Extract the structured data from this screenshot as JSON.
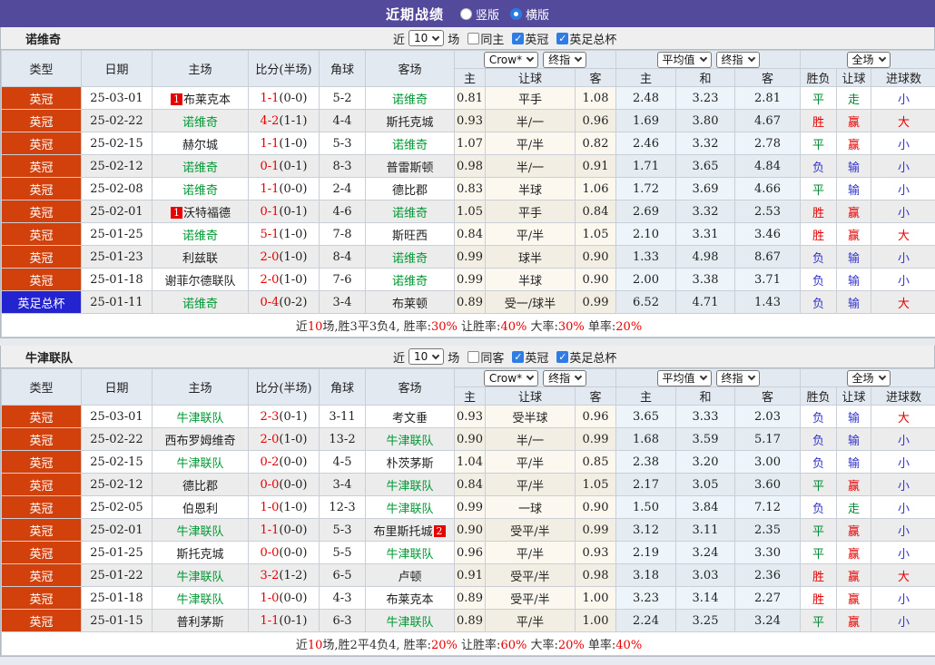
{
  "colors": {
    "titlebar_purple": "#534a9c",
    "league_badge_orange": "#d2410c",
    "cup_badge_blue": "#2323cf",
    "team_highlight_green": "#009933",
    "score_red": "#e60000",
    "win_red": "#e60000",
    "draw_green": "#008833",
    "lose_blue": "#3434cd",
    "checkbox_blue": "#2e7ce4"
  },
  "titlebar": {
    "title": "近期战绩",
    "radios": [
      {
        "label": "竖版",
        "selected": false
      },
      {
        "label": "横版",
        "selected": true
      }
    ]
  },
  "column_headers": {
    "static": [
      "类型",
      "日期",
      "主场",
      "比分(半场)",
      "角球",
      "客场"
    ],
    "sub": [
      "主",
      "让球",
      "客",
      "主",
      "和",
      "客",
      "胜负",
      "让球",
      "进球数"
    ]
  },
  "tables": [
    {
      "team": "诺维奇",
      "filter": {
        "near": "近",
        "games": "10",
        "unit": "场",
        "checks": [
          {
            "label": "同主",
            "checked": false
          },
          {
            "label": "英冠",
            "checked": true
          },
          {
            "label": "英足总杯",
            "checked": true
          }
        ]
      },
      "dropdowns": {
        "odds": [
          "Crow*",
          "终指"
        ],
        "europe": [
          "平均值",
          "终指"
        ],
        "scope": [
          "全场"
        ]
      },
      "rows": [
        {
          "lt": "英冠",
          "cup": false,
          "date": "25-03-01",
          "h": "布莱克本",
          "hb": "1",
          "hbp": "b",
          "hhl": false,
          "ft": "1-1",
          "ht": "(0-0)",
          "cn": "5-2",
          "a": "诺维奇",
          "ahl": true,
          "crown": [
            "0.81",
            "平手",
            "1.08"
          ],
          "avg": [
            "2.48",
            "3.23",
            "2.81"
          ],
          "oc": [
            [
              "平",
              "g"
            ],
            [
              "走",
              "g"
            ],
            [
              "小",
              "b"
            ]
          ]
        },
        {
          "lt": "英冠",
          "cup": false,
          "date": "25-02-22",
          "h": "诺维奇",
          "hhl": true,
          "ft": "4-2",
          "ht": "(1-1)",
          "cn": "4-4",
          "a": "斯托克城",
          "ahl": false,
          "crown": [
            "0.93",
            "半/一",
            "0.96"
          ],
          "avg": [
            "1.69",
            "3.80",
            "4.67"
          ],
          "oc": [
            [
              "胜",
              "r"
            ],
            [
              "赢",
              "r"
            ],
            [
              "大",
              "r"
            ]
          ]
        },
        {
          "lt": "英冠",
          "cup": false,
          "date": "25-02-15",
          "h": "赫尔城",
          "hhl": false,
          "ft": "1-1",
          "ht": "(1-0)",
          "cn": "5-3",
          "a": "诺维奇",
          "ahl": true,
          "crown": [
            "1.07",
            "平/半",
            "0.82"
          ],
          "avg": [
            "2.46",
            "3.32",
            "2.78"
          ],
          "oc": [
            [
              "平",
              "g"
            ],
            [
              "赢",
              "r"
            ],
            [
              "小",
              "b"
            ]
          ]
        },
        {
          "lt": "英冠",
          "cup": false,
          "date": "25-02-12",
          "h": "诺维奇",
          "hhl": true,
          "ft": "0-1",
          "ht": "(0-1)",
          "cn": "8-3",
          "a": "普雷斯顿",
          "ahl": false,
          "crown": [
            "0.98",
            "半/一",
            "0.91"
          ],
          "avg": [
            "1.71",
            "3.65",
            "4.84"
          ],
          "oc": [
            [
              "负",
              "b"
            ],
            [
              "输",
              "b"
            ],
            [
              "小",
              "b"
            ]
          ]
        },
        {
          "lt": "英冠",
          "cup": false,
          "date": "25-02-08",
          "h": "诺维奇",
          "hhl": true,
          "ft": "1-1",
          "ht": "(0-0)",
          "cn": "2-4",
          "a": "德比郡",
          "ahl": false,
          "crown": [
            "0.83",
            "半球",
            "1.06"
          ],
          "avg": [
            "1.72",
            "3.69",
            "4.66"
          ],
          "oc": [
            [
              "平",
              "g"
            ],
            [
              "输",
              "b"
            ],
            [
              "小",
              "b"
            ]
          ]
        },
        {
          "lt": "英冠",
          "cup": false,
          "date": "25-02-01",
          "h": "沃特福德",
          "hb": "1",
          "hbp": "b",
          "hhl": false,
          "ft": "0-1",
          "ht": "(0-1)",
          "cn": "4-6",
          "a": "诺维奇",
          "ahl": true,
          "crown": [
            "1.05",
            "平手",
            "0.84"
          ],
          "avg": [
            "2.69",
            "3.32",
            "2.53"
          ],
          "oc": [
            [
              "胜",
              "r"
            ],
            [
              "赢",
              "r"
            ],
            [
              "小",
              "b"
            ]
          ]
        },
        {
          "lt": "英冠",
          "cup": false,
          "date": "25-01-25",
          "h": "诺维奇",
          "hhl": true,
          "ft": "5-1",
          "ht": "(1-0)",
          "cn": "7-8",
          "a": "斯旺西",
          "ahl": false,
          "crown": [
            "0.84",
            "平/半",
            "1.05"
          ],
          "avg": [
            "2.10",
            "3.31",
            "3.46"
          ],
          "oc": [
            [
              "胜",
              "r"
            ],
            [
              "赢",
              "r"
            ],
            [
              "大",
              "r"
            ]
          ]
        },
        {
          "lt": "英冠",
          "cup": false,
          "date": "25-01-23",
          "h": "利兹联",
          "hhl": false,
          "ft": "2-0",
          "ht": "(1-0)",
          "cn": "8-4",
          "a": "诺维奇",
          "ahl": true,
          "crown": [
            "0.99",
            "球半",
            "0.90"
          ],
          "avg": [
            "1.33",
            "4.98",
            "8.67"
          ],
          "oc": [
            [
              "负",
              "b"
            ],
            [
              "输",
              "b"
            ],
            [
              "小",
              "b"
            ]
          ]
        },
        {
          "lt": "英冠",
          "cup": false,
          "date": "25-01-18",
          "h": "谢菲尔德联队",
          "hhl": false,
          "ft": "2-0",
          "ht": "(1-0)",
          "cn": "7-6",
          "a": "诺维奇",
          "ahl": true,
          "crown": [
            "0.99",
            "半球",
            "0.90"
          ],
          "avg": [
            "2.00",
            "3.38",
            "3.71"
          ],
          "oc": [
            [
              "负",
              "b"
            ],
            [
              "输",
              "b"
            ],
            [
              "小",
              "b"
            ]
          ]
        },
        {
          "lt": "英足总杯",
          "cup": true,
          "date": "25-01-11",
          "h": "诺维奇",
          "hhl": true,
          "ft": "0-4",
          "ht": "(0-2)",
          "cn": "3-4",
          "a": "布莱顿",
          "ahl": false,
          "crown": [
            "0.89",
            "受一/球半",
            "0.99"
          ],
          "avg": [
            "6.52",
            "4.71",
            "1.43"
          ],
          "oc": [
            [
              "负",
              "b"
            ],
            [
              "输",
              "b"
            ],
            [
              "大",
              "r"
            ]
          ]
        }
      ],
      "summary": [
        {
          "t": "近"
        },
        {
          "t": "10",
          "red": true
        },
        {
          "t": "场,胜3平3负4, 胜率:"
        },
        {
          "t": "30%",
          "red": true
        },
        {
          "t": " 让胜率:"
        },
        {
          "t": "40%",
          "red": true
        },
        {
          "t": " 大率:"
        },
        {
          "t": "30%",
          "red": true
        },
        {
          "t": " 单率:"
        },
        {
          "t": "20%",
          "red": true
        }
      ]
    },
    {
      "team": "牛津联队",
      "filter": {
        "near": "近",
        "games": "10",
        "unit": "场",
        "checks": [
          {
            "label": "同客",
            "checked": false
          },
          {
            "label": "英冠",
            "checked": true
          },
          {
            "label": "英足总杯",
            "checked": true
          }
        ]
      },
      "dropdowns": {
        "odds": [
          "Crow*",
          "终指"
        ],
        "europe": [
          "平均值",
          "终指"
        ],
        "scope": [
          "全场"
        ]
      },
      "rows": [
        {
          "lt": "英冠",
          "cup": false,
          "date": "25-03-01",
          "h": "牛津联队",
          "hhl": true,
          "ft": "2-3",
          "ht": "(0-1)",
          "cn": "3-11",
          "a": "考文垂",
          "ahl": false,
          "crown": [
            "0.93",
            "受半球",
            "0.96"
          ],
          "avg": [
            "3.65",
            "3.33",
            "2.03"
          ],
          "oc": [
            [
              "负",
              "b"
            ],
            [
              "输",
              "b"
            ],
            [
              "大",
              "r"
            ]
          ]
        },
        {
          "lt": "英冠",
          "cup": false,
          "date": "25-02-22",
          "h": "西布罗姆维奇",
          "hhl": false,
          "ft": "2-0",
          "ht": "(1-0)",
          "cn": "13-2",
          "a": "牛津联队",
          "ahl": true,
          "crown": [
            "0.90",
            "半/一",
            "0.99"
          ],
          "avg": [
            "1.68",
            "3.59",
            "5.17"
          ],
          "oc": [
            [
              "负",
              "b"
            ],
            [
              "输",
              "b"
            ],
            [
              "小",
              "b"
            ]
          ]
        },
        {
          "lt": "英冠",
          "cup": false,
          "date": "25-02-15",
          "h": "牛津联队",
          "hhl": true,
          "ft": "0-2",
          "ht": "(0-0)",
          "cn": "4-5",
          "a": "朴茨茅斯",
          "ahl": false,
          "crown": [
            "1.04",
            "平/半",
            "0.85"
          ],
          "avg": [
            "2.38",
            "3.20",
            "3.00"
          ],
          "oc": [
            [
              "负",
              "b"
            ],
            [
              "输",
              "b"
            ],
            [
              "小",
              "b"
            ]
          ]
        },
        {
          "lt": "英冠",
          "cup": false,
          "date": "25-02-12",
          "h": "德比郡",
          "hhl": false,
          "ft": "0-0",
          "ht": "(0-0)",
          "cn": "3-4",
          "a": "牛津联队",
          "ahl": true,
          "crown": [
            "0.84",
            "平/半",
            "1.05"
          ],
          "avg": [
            "2.17",
            "3.05",
            "3.60"
          ],
          "oc": [
            [
              "平",
              "g"
            ],
            [
              "赢",
              "r"
            ],
            [
              "小",
              "b"
            ]
          ]
        },
        {
          "lt": "英冠",
          "cup": false,
          "date": "25-02-05",
          "h": "伯恩利",
          "hhl": false,
          "ft": "1-0",
          "ht": "(1-0)",
          "cn": "12-3",
          "a": "牛津联队",
          "ahl": true,
          "crown": [
            "0.99",
            "一球",
            "0.90"
          ],
          "avg": [
            "1.50",
            "3.84",
            "7.12"
          ],
          "oc": [
            [
              "负",
              "b"
            ],
            [
              "走",
              "g"
            ],
            [
              "小",
              "b"
            ]
          ]
        },
        {
          "lt": "英冠",
          "cup": false,
          "date": "25-02-01",
          "h": "牛津联队",
          "hhl": true,
          "ft": "1-1",
          "ht": "(0-0)",
          "cn": "5-3",
          "a": "布里斯托城",
          "ab": "2",
          "abp": "a",
          "ahl": false,
          "crown": [
            "0.90",
            "受平/半",
            "0.99"
          ],
          "avg": [
            "3.12",
            "3.11",
            "2.35"
          ],
          "oc": [
            [
              "平",
              "g"
            ],
            [
              "赢",
              "r"
            ],
            [
              "小",
              "b"
            ]
          ]
        },
        {
          "lt": "英冠",
          "cup": false,
          "date": "25-01-25",
          "h": "斯托克城",
          "hhl": false,
          "ft": "0-0",
          "ht": "(0-0)",
          "cn": "5-5",
          "a": "牛津联队",
          "ahl": true,
          "crown": [
            "0.96",
            "平/半",
            "0.93"
          ],
          "avg": [
            "2.19",
            "3.24",
            "3.30"
          ],
          "oc": [
            [
              "平",
              "g"
            ],
            [
              "赢",
              "r"
            ],
            [
              "小",
              "b"
            ]
          ]
        },
        {
          "lt": "英冠",
          "cup": false,
          "date": "25-01-22",
          "h": "牛津联队",
          "hhl": true,
          "ft": "3-2",
          "ht": "(1-2)",
          "cn": "6-5",
          "a": "卢顿",
          "ahl": false,
          "crown": [
            "0.91",
            "受平/半",
            "0.98"
          ],
          "avg": [
            "3.18",
            "3.03",
            "2.36"
          ],
          "oc": [
            [
              "胜",
              "r"
            ],
            [
              "赢",
              "r"
            ],
            [
              "大",
              "r"
            ]
          ]
        },
        {
          "lt": "英冠",
          "cup": false,
          "date": "25-01-18",
          "h": "牛津联队",
          "hhl": true,
          "ft": "1-0",
          "ht": "(0-0)",
          "cn": "4-3",
          "a": "布莱克本",
          "ahl": false,
          "crown": [
            "0.89",
            "受平/半",
            "1.00"
          ],
          "avg": [
            "3.23",
            "3.14",
            "2.27"
          ],
          "oc": [
            [
              "胜",
              "r"
            ],
            [
              "赢",
              "r"
            ],
            [
              "小",
              "b"
            ]
          ]
        },
        {
          "lt": "英冠",
          "cup": false,
          "date": "25-01-15",
          "h": "普利茅斯",
          "hhl": false,
          "ft": "1-1",
          "ht": "(0-1)",
          "cn": "6-3",
          "a": "牛津联队",
          "ahl": true,
          "crown": [
            "0.89",
            "平/半",
            "1.00"
          ],
          "avg": [
            "2.24",
            "3.25",
            "3.24"
          ],
          "oc": [
            [
              "平",
              "g"
            ],
            [
              "赢",
              "r"
            ],
            [
              "小",
              "b"
            ]
          ]
        }
      ],
      "summary": [
        {
          "t": "近"
        },
        {
          "t": "10",
          "red": true
        },
        {
          "t": "场,胜2平4负4, 胜率:"
        },
        {
          "t": "20%",
          "red": true
        },
        {
          "t": " 让胜率:"
        },
        {
          "t": "60%",
          "red": true
        },
        {
          "t": " 大率:"
        },
        {
          "t": "20%",
          "red": true
        },
        {
          "t": " 单率:"
        },
        {
          "t": "40%",
          "red": true
        }
      ]
    }
  ]
}
